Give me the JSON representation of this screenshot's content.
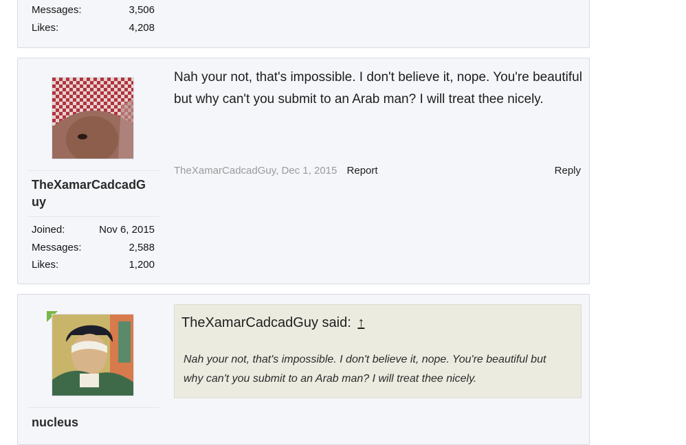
{
  "post_top": {
    "stats": [
      {
        "label": "Messages:",
        "value": "3,506"
      },
      {
        "label": "Likes:",
        "value": "4,208"
      }
    ]
  },
  "post_mid": {
    "username_line1": "TheXamarCadcadG",
    "username_line2": "uy",
    "stats": [
      {
        "label": "Joined:",
        "value": "Nov 6, 2015"
      },
      {
        "label": "Messages:",
        "value": "2,588"
      },
      {
        "label": "Likes:",
        "value": "1,200"
      }
    ],
    "message_line1": "Nah your not, that's impossible. I don't believe it, nope. You're beautiful",
    "message_line2": "but why can't you submit to an Arab man? I will treat thee nicely.",
    "author_date": "TheXamarCadcadGuy, Dec 1, 2015",
    "report_label": "Report",
    "reply_label": "Reply"
  },
  "post_bot": {
    "username": "nucleus",
    "quote_author": "TheXamarCadcadGuy said:",
    "quote_arrow": "↑",
    "quote_line1": "Nah your not, that's impossible. I don't believe it, nope. You're beautiful but",
    "quote_line2": "why can't you submit to an Arab man? I will treat thee nicely."
  },
  "colors": {
    "post_bg": "#f5f6fa",
    "quote_bg": "#ecebe0",
    "meta_gray": "#9a9a9a",
    "badge_green": "#7ab648"
  },
  "icons": {
    "avatar_mid": "user-avatar-keffiyeh",
    "avatar_bot": "user-avatar-portrait",
    "quote_jump": "arrow-up-icon"
  }
}
